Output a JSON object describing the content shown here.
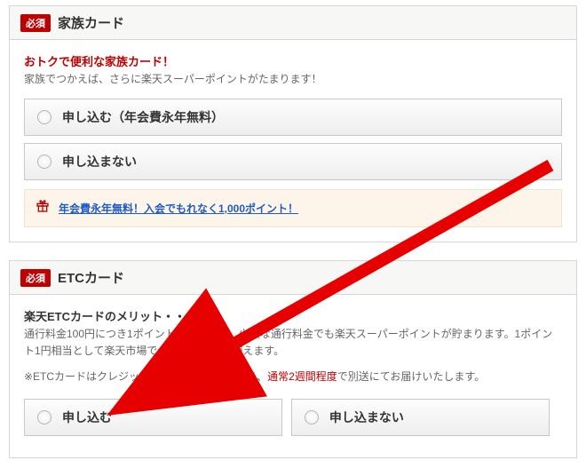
{
  "required_label": "必須",
  "family": {
    "title": "家族カード",
    "lead": "おトクで便利な家族カード！",
    "sublead": "家族でつかえば、さらに楽天スーパーポイントがたまります！",
    "apply": "申し込む（年会費永年無料）",
    "not_apply": "申し込まない",
    "promo_link": "年会費永年無料！入会でもれなく1,000ポイント！"
  },
  "etc": {
    "title": "ETCカード",
    "merit_title": "楽天ETCカードのメリット・・",
    "merit_text_a": "通行料金100円につき1ポイントたまるので、少額な通行料金でも楽天スーパーポイントが貯まります。1ポイント1円相当として楽天市場でのお買い物等に使えます。",
    "note_prefix": "※ETCカードはクレジットカードをお受け取り後、",
    "note_red": "通常2週間程度",
    "note_suffix": "で別送にてお届けいたします。",
    "apply": "申し込む",
    "not_apply": "申し込まない"
  }
}
